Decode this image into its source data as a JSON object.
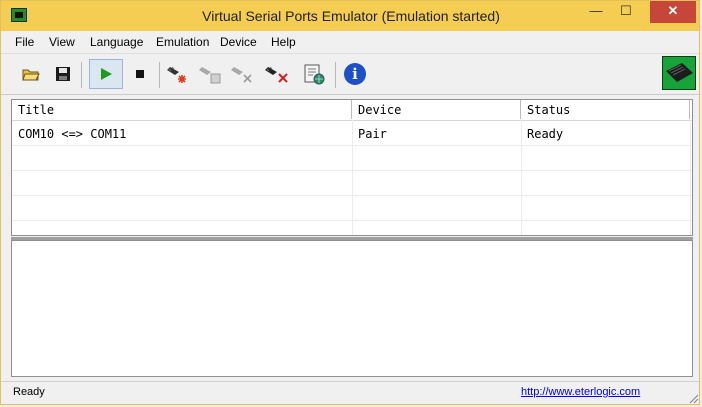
{
  "window": {
    "title": "Virtual Serial Ports Emulator (Emulation started)",
    "min_glyph": "—",
    "max_glyph": "☐",
    "close_glyph": "✕"
  },
  "menu": [
    "File",
    "View",
    "Language",
    "Emulation",
    "Device",
    "Help"
  ],
  "toolbar": {
    "icons": [
      "open-folder-icon",
      "save-icon",
      "play-icon",
      "stop-icon",
      "new-device-icon",
      "edit-device-icon",
      "disable-device-icon",
      "delete-device-icon",
      "options-icon",
      "info-icon"
    ],
    "info_glyph": "i"
  },
  "table": {
    "columns": [
      "Title",
      "Device",
      "Status"
    ],
    "rows": [
      {
        "title": "COM10 <=> COM11",
        "device": "Pair",
        "status": "Ready"
      }
    ]
  },
  "status": {
    "text": "Ready",
    "link": "http://www.eterlogic.com"
  },
  "colors": {
    "titlebar": "#f4cd52",
    "close": "#c7463a",
    "link": "#0000ee",
    "play": "#1e9a1e",
    "info": "#1d50c8"
  }
}
